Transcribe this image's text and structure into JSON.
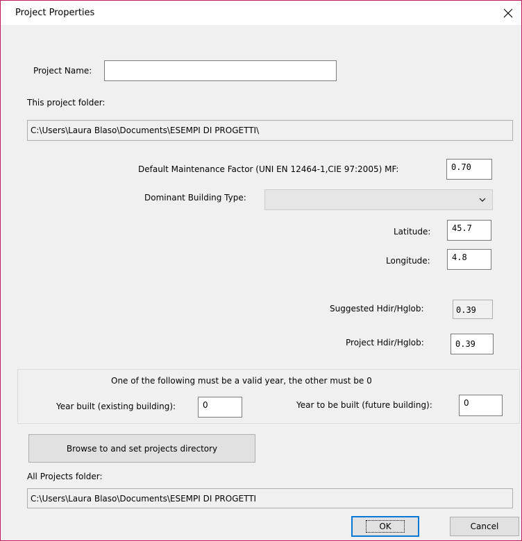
{
  "window": {
    "title": "Project Properties"
  },
  "icons": {
    "close": "close-icon",
    "dropdown": "chevron-down-icon"
  },
  "colors": {
    "accent_border": "#c2185b",
    "default_button_border": "#0078d7"
  },
  "form": {
    "project_name": {
      "label": "Project Name:",
      "value": ""
    },
    "project_folder": {
      "label": "This project folder:",
      "value": "C:\\Users\\Laura Blaso\\Documents\\ESEMPI DI PROGETTI\\"
    },
    "maintenance_factor": {
      "label": "Default Maintenance Factor (UNI EN 12464-1,CIE 97:2005) MF:",
      "value": "0.70"
    },
    "building_type": {
      "label": "Dominant Building Type:",
      "value": ""
    },
    "latitude": {
      "label": "Latitude:",
      "value": "45.7"
    },
    "longitude": {
      "label": "Longitude:",
      "value": "4.8"
    },
    "suggested_hdir": {
      "label": "Suggested Hdir/Hglob:",
      "value": "0.39"
    },
    "project_hdir": {
      "label": "Project Hdir/Hglob:",
      "value": "0.39"
    }
  },
  "year_group": {
    "note": "One of the following must be a valid year, the other  must be 0",
    "year_built": {
      "label": "Year built (existing building):",
      "value": "0"
    },
    "year_future": {
      "label": "Year to be built (future building):",
      "value": "0"
    }
  },
  "browse_button": "Browse to and set projects directory",
  "all_projects": {
    "label": "All Projects folder:",
    "value": "C:\\Users\\Laura Blaso\\Documents\\ESEMPI DI PROGETTI"
  },
  "buttons": {
    "ok": "OK",
    "cancel": "Cancel"
  }
}
